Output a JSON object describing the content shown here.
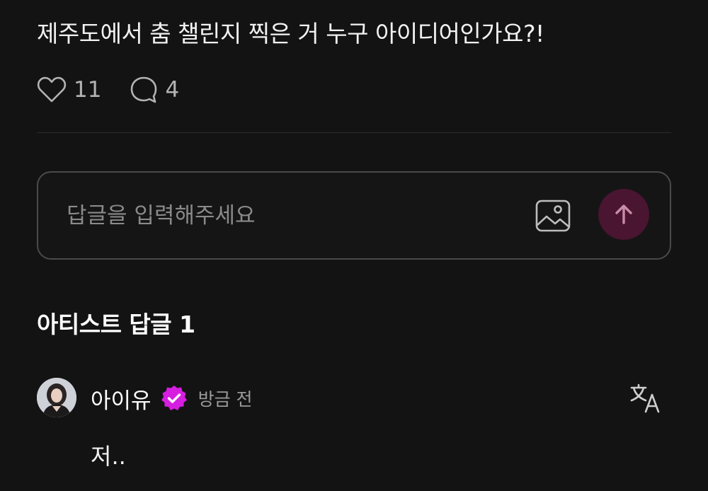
{
  "post": {
    "text": "제주도에서 춤 챌린지 찍은 거 누구 아이디어인가요?!",
    "likes": "11",
    "comments": "4"
  },
  "reply": {
    "placeholder": "답글을 입력해주세요",
    "send_color": "#4a1530",
    "send_arrow_color": "#c98ba8"
  },
  "artist_replies": {
    "title": "아티스트 답글 1",
    "items": [
      {
        "author": "아이유",
        "verified_color": "#d61ee0",
        "time": "방금 전",
        "text": "저.."
      }
    ]
  },
  "icons": {
    "like": "heart-outline-icon",
    "comment": "speech-bubble-icon",
    "image": "image-icon",
    "send": "arrow-up-icon",
    "verified": "verified-badge-icon",
    "translate": "translate-icon"
  }
}
